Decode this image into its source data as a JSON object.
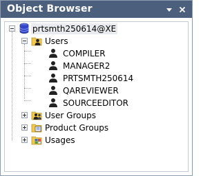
{
  "panel": {
    "title": "Object Browser",
    "pin_icon": "pin-dropdown-icon",
    "close_icon": "close-icon"
  },
  "tree": {
    "root": {
      "label": "prtsmth250614@XE",
      "icon": "database-icon",
      "expanded": true
    },
    "users": {
      "label": "Users",
      "icon": "users-folder-icon",
      "expanded": true,
      "items": [
        {
          "label": "COMPILER",
          "icon": "user-icon"
        },
        {
          "label": "MANAGER2",
          "icon": "user-icon"
        },
        {
          "label": "PRTSMTH250614",
          "icon": "user-icon"
        },
        {
          "label": "QAREVIEWER",
          "icon": "user-icon"
        },
        {
          "label": "SOURCEEDITOR",
          "icon": "user-icon"
        }
      ]
    },
    "groups": [
      {
        "label": "User Groups",
        "icon": "user-groups-folder-icon",
        "expanded": false
      },
      {
        "label": "Product Groups",
        "icon": "product-groups-folder-icon",
        "expanded": false
      },
      {
        "label": "Usages",
        "icon": "usages-folder-icon",
        "expanded": false
      }
    ]
  },
  "colors": {
    "titlebar": "#4c607e",
    "border": "#8e9cb2",
    "selection": "#e9ebee",
    "folder": "#f2c94c"
  }
}
